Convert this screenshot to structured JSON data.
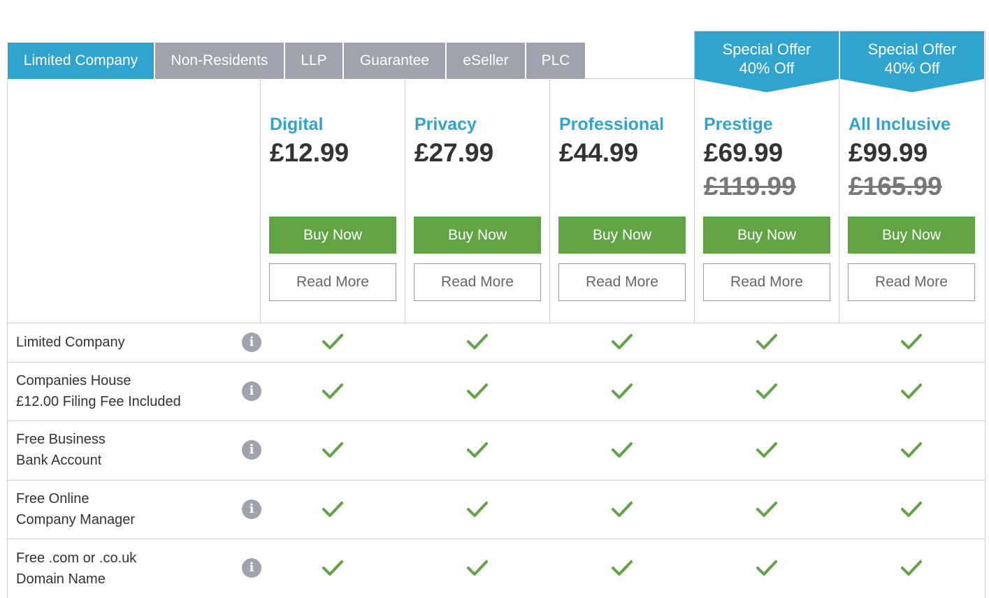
{
  "tabs": [
    {
      "label": "Limited Company",
      "active": true
    },
    {
      "label": "Non-Residents",
      "active": false
    },
    {
      "label": "LLP",
      "active": false
    },
    {
      "label": "Guarantee",
      "active": false
    },
    {
      "label": "eSeller",
      "active": false
    },
    {
      "label": "PLC",
      "active": false
    }
  ],
  "offer_banner": {
    "line1": "Special Offer",
    "line2": "40% Off"
  },
  "plans": [
    {
      "name": "Digital",
      "price": "£12.99",
      "old_price": "",
      "buy_label": "Buy Now",
      "read_label": "Read More"
    },
    {
      "name": "Privacy",
      "price": "£27.99",
      "old_price": "",
      "buy_label": "Buy Now",
      "read_label": "Read More"
    },
    {
      "name": "Professional",
      "price": "£44.99",
      "old_price": "",
      "buy_label": "Buy Now",
      "read_label": "Read More"
    },
    {
      "name": "Prestige",
      "price": "£69.99",
      "old_price": "£119.99",
      "buy_label": "Buy Now",
      "read_label": "Read More"
    },
    {
      "name": "All Inclusive",
      "price": "£99.99",
      "old_price": "£165.99",
      "buy_label": "Buy Now",
      "read_label": "Read More"
    }
  ],
  "features": [
    {
      "line1": "Limited Company",
      "line2": "",
      "included": [
        true,
        true,
        true,
        true,
        true
      ]
    },
    {
      "line1": "Companies House",
      "line2": "£12.00 Filing Fee Included",
      "included": [
        true,
        true,
        true,
        true,
        true
      ]
    },
    {
      "line1": "Free Business",
      "line2": "Bank Account",
      "included": [
        true,
        true,
        true,
        true,
        true
      ]
    },
    {
      "line1": "Free Online",
      "line2": "Company Manager",
      "included": [
        true,
        true,
        true,
        true,
        true
      ]
    },
    {
      "line1": "Free .com or .co.uk",
      "line2": "Domain Name",
      "included": [
        true,
        true,
        true,
        true,
        true
      ]
    }
  ],
  "info_icon_glyph": "i",
  "colors": {
    "accent": "#2fa4cf",
    "tab_inactive": "#9ea3ae",
    "buy": "#60a443",
    "check": "#60a443"
  }
}
